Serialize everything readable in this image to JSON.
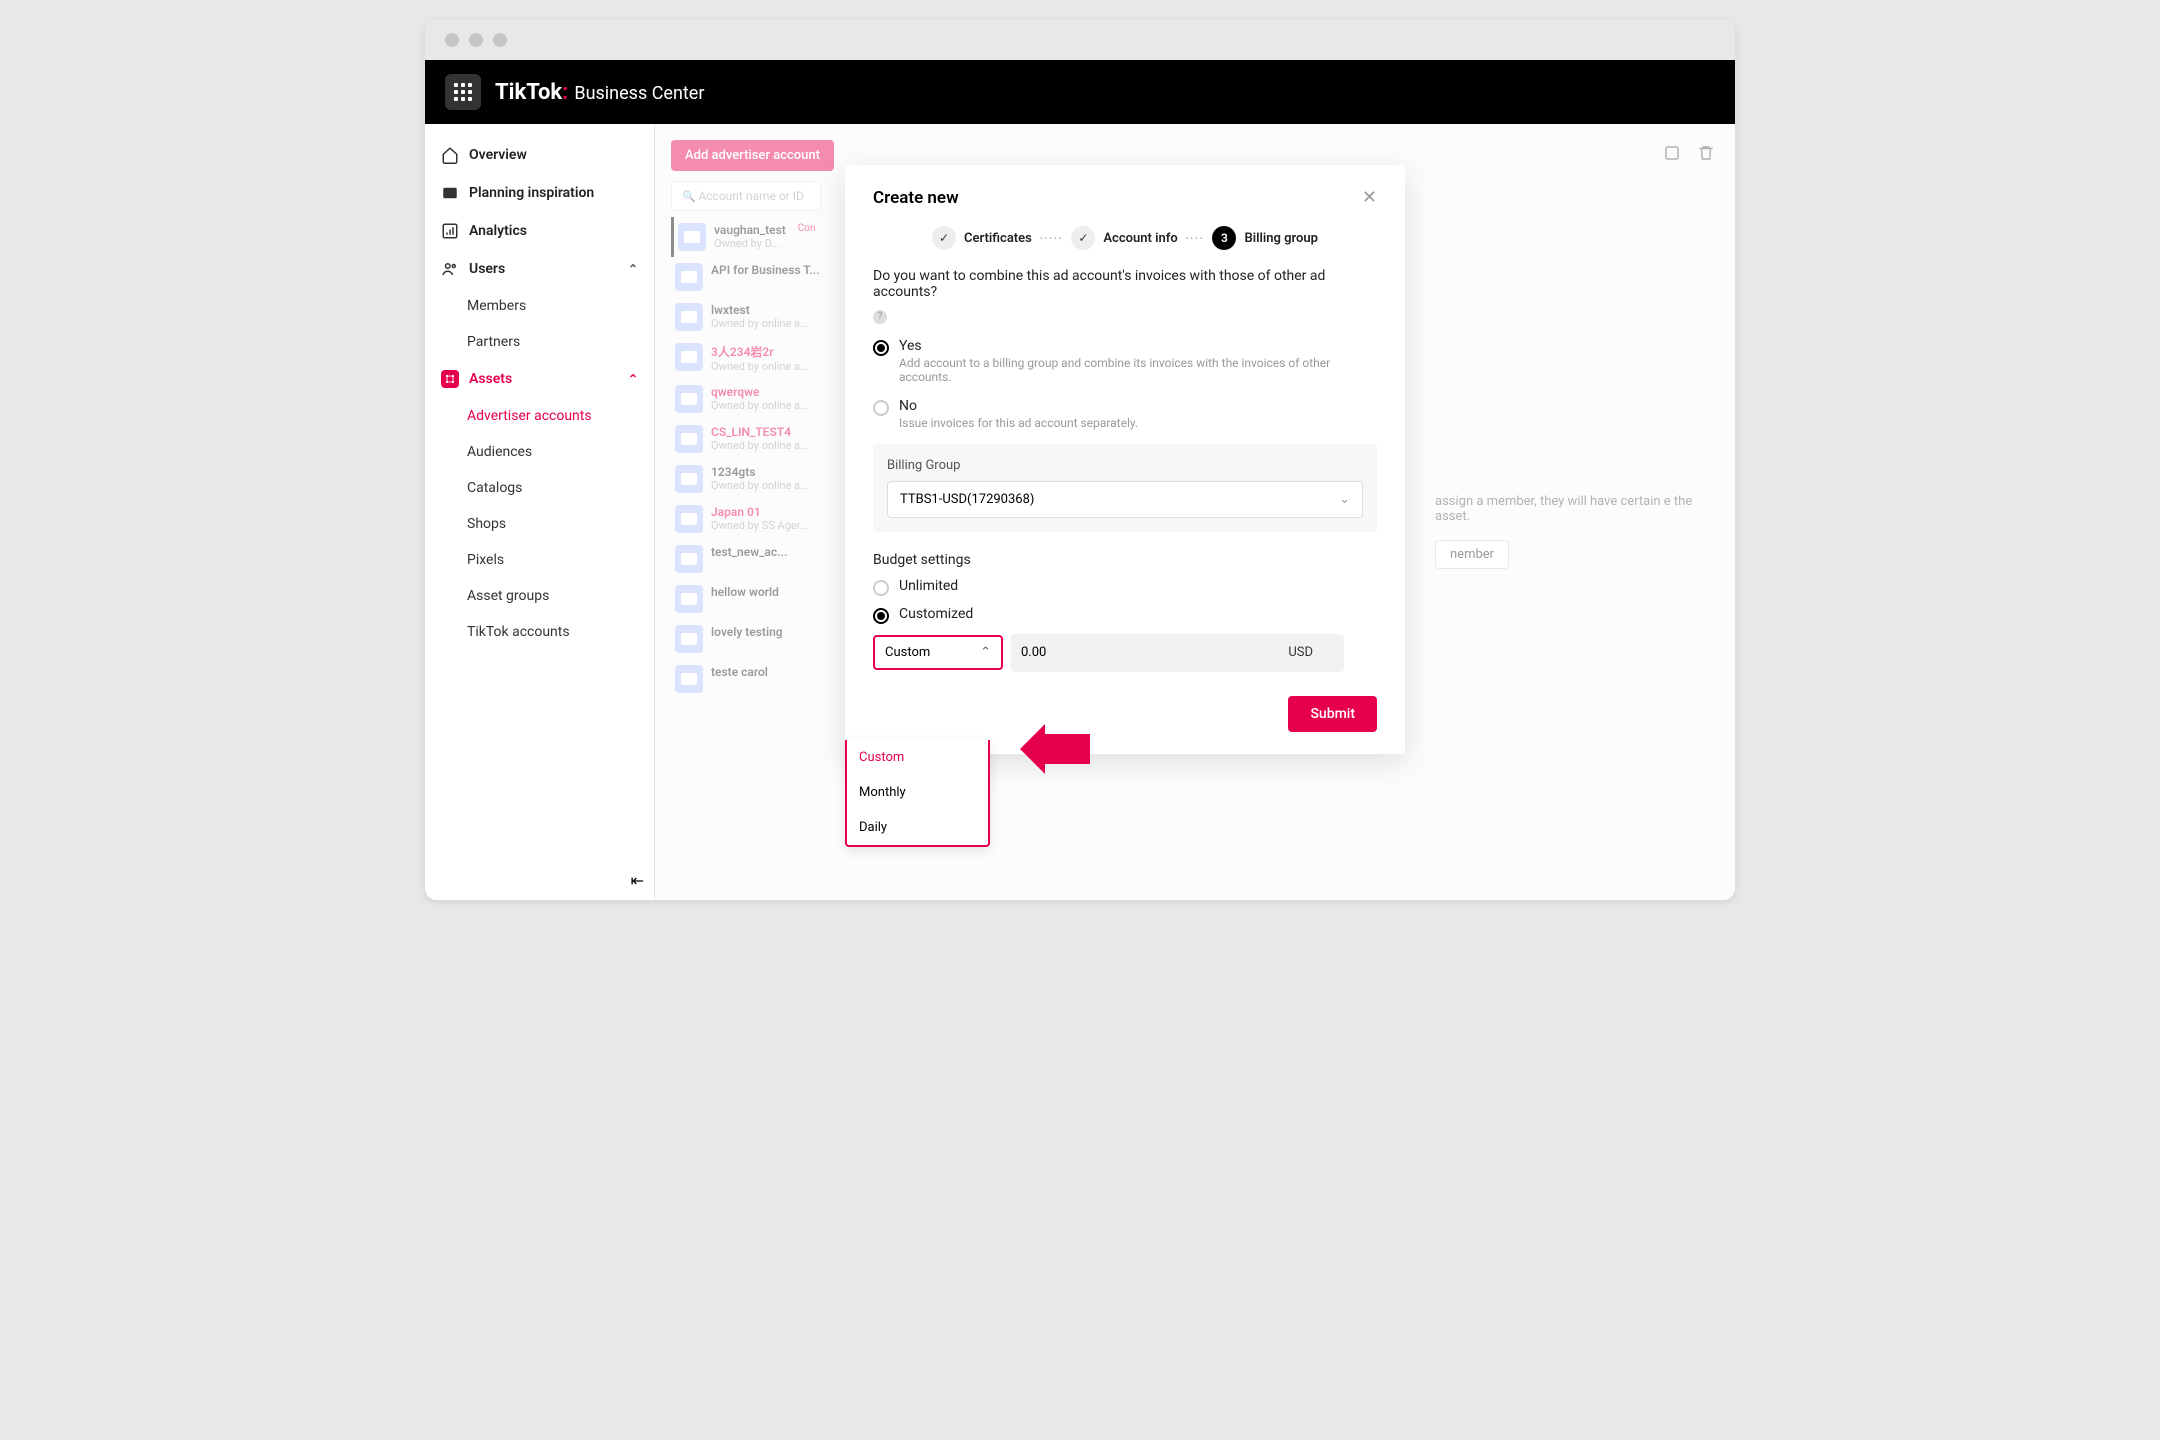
{
  "header": {
    "brand": "TikTok",
    "subtitle": "Business Center"
  },
  "sidebar": {
    "overview": "Overview",
    "planning": "Planning inspiration",
    "analytics": "Analytics",
    "users": "Users",
    "members": "Members",
    "partners": "Partners",
    "assets": "Assets",
    "advertiser_accounts": "Advertiser accounts",
    "audiences": "Audiences",
    "catalogs": "Catalogs",
    "shops": "Shops",
    "pixels": "Pixels",
    "asset_groups": "Asset groups",
    "tiktok_accounts": "TikTok accounts"
  },
  "main": {
    "add_button": "Add advertiser account",
    "search_placeholder": "Account name or ID",
    "accounts": [
      {
        "name": "vaughan_test",
        "sub": "Owned by D...",
        "red": false,
        "sel": true,
        "tag": "Con"
      },
      {
        "name": "API for Business T...",
        "sub": "",
        "red": false
      },
      {
        "name": "lwxtest",
        "sub": "Owned by online a...",
        "red": false
      },
      {
        "name": "3人234岩2r",
        "sub": "Owned by online a...",
        "red": true
      },
      {
        "name": "qwerqwe",
        "sub": "Owned by online a...",
        "red": true
      },
      {
        "name": "CS_LIN_TEST4",
        "sub": "Owned by online a...",
        "red": true
      },
      {
        "name": "1234gts",
        "sub": "Owned by online a...",
        "red": false
      },
      {
        "name": "Japan 01",
        "sub": "Owned by SS Ager...",
        "red": true
      },
      {
        "name": "test_new_ac...",
        "sub": "",
        "red": false
      },
      {
        "name": "hellow world",
        "sub": "",
        "red": false
      },
      {
        "name": "lovely testing",
        "sub": "",
        "red": false
      },
      {
        "name": "teste carol",
        "sub": "",
        "red": false
      }
    ],
    "assign_text": "assign a member, they will have certain e the asset.",
    "assign_button": "nember"
  },
  "modal": {
    "title": "Create new",
    "steps": {
      "s1": "Certificates",
      "s2": "Account info",
      "s3_num": "3",
      "s3": "Billing group"
    },
    "question": "Do you want to combine this ad account's invoices with those of other ad accounts?",
    "yes_label": "Yes",
    "yes_desc": "Add account to a billing group and combine its invoices with the invoices of other accounts.",
    "no_label": "No",
    "no_desc": "Issue invoices for this ad account separately.",
    "billing_group_label": "Billing Group",
    "billing_group_value": "TTBS1-USD(17290368)",
    "budget_title": "Budget settings",
    "unlimited": "Unlimited",
    "customized": "Customized",
    "custom_select": "Custom",
    "amount": "0.00",
    "currency": "USD",
    "submit": "Submit",
    "dd_options": [
      "Custom",
      "Monthly",
      "Daily"
    ]
  }
}
